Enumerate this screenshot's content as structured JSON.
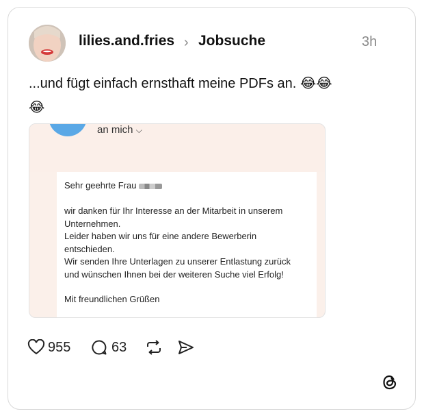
{
  "post": {
    "author": "lilies.and.fries",
    "topic": "Jobsuche",
    "time": "3h",
    "text": "...und fügt einfach ernsthaft meine PDFs an.",
    "emojis_line1": "😂😂",
    "emojis_line2": "😂"
  },
  "email": {
    "recipient": "an mich",
    "greeting": "Sehr geehrte Frau",
    "lines": [
      "wir danken für Ihr Interesse an der Mitarbeit in unserem",
      "Unternehmen.",
      "Leider haben wir uns für eine andere Bewerberin",
      "entschieden.",
      "Wir senden Ihre Unterlagen zu unserer Entlastung zurück",
      "und wünschen Ihnen bei der weiteren Suche viel Erfolg!"
    ],
    "closing": "Mit freundlichen Grüßen"
  },
  "actions": {
    "likes": "955",
    "replies": "63"
  },
  "icons": {
    "like": "heart-icon",
    "reply": "comment-icon",
    "repost": "repost-icon",
    "share": "send-icon",
    "brand": "threads-logo-icon"
  }
}
